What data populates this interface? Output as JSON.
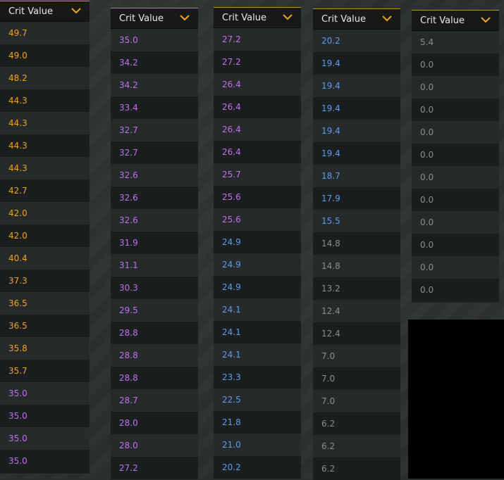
{
  "header_label": "Crit Value",
  "colors": {
    "gold": "#f0a320",
    "purple": "#c070f0",
    "blue": "#5d9cf0",
    "gray": "#8a8e8e"
  },
  "icons": {
    "header_dropdown": "chevron-down-icon"
  },
  "columns": [
    {
      "label": "Crit Value",
      "values": [
        {
          "v": "49.7",
          "c": "gold"
        },
        {
          "v": "49.0",
          "c": "gold"
        },
        {
          "v": "48.2",
          "c": "gold"
        },
        {
          "v": "44.3",
          "c": "gold"
        },
        {
          "v": "44.3",
          "c": "gold"
        },
        {
          "v": "44.3",
          "c": "gold"
        },
        {
          "v": "44.3",
          "c": "gold"
        },
        {
          "v": "42.7",
          "c": "gold"
        },
        {
          "v": "42.0",
          "c": "gold"
        },
        {
          "v": "42.0",
          "c": "gold"
        },
        {
          "v": "40.4",
          "c": "gold"
        },
        {
          "v": "37.3",
          "c": "gold"
        },
        {
          "v": "36.5",
          "c": "gold"
        },
        {
          "v": "36.5",
          "c": "gold"
        },
        {
          "v": "35.8",
          "c": "gold"
        },
        {
          "v": "35.7",
          "c": "gold"
        },
        {
          "v": "35.0",
          "c": "purple"
        },
        {
          "v": "35.0",
          "c": "purple"
        },
        {
          "v": "35.0",
          "c": "purple"
        },
        {
          "v": "35.0",
          "c": "purple"
        }
      ]
    },
    {
      "label": "Crit Value",
      "values": [
        {
          "v": "35.0",
          "c": "purple"
        },
        {
          "v": "34.2",
          "c": "purple"
        },
        {
          "v": "34.2",
          "c": "purple"
        },
        {
          "v": "33.4",
          "c": "purple"
        },
        {
          "v": "32.7",
          "c": "purple"
        },
        {
          "v": "32.7",
          "c": "purple"
        },
        {
          "v": "32.6",
          "c": "purple"
        },
        {
          "v": "32.6",
          "c": "purple"
        },
        {
          "v": "32.6",
          "c": "purple"
        },
        {
          "v": "31.9",
          "c": "purple"
        },
        {
          "v": "31.1",
          "c": "purple"
        },
        {
          "v": "30.3",
          "c": "purple"
        },
        {
          "v": "29.5",
          "c": "purple"
        },
        {
          "v": "28.8",
          "c": "purple"
        },
        {
          "v": "28.8",
          "c": "purple"
        },
        {
          "v": "28.8",
          "c": "purple"
        },
        {
          "v": "28.7",
          "c": "purple"
        },
        {
          "v": "28.0",
          "c": "purple"
        },
        {
          "v": "28.0",
          "c": "purple"
        },
        {
          "v": "27.2",
          "c": "purple"
        }
      ]
    },
    {
      "label": "Crit Value",
      "values": [
        {
          "v": "27.2",
          "c": "purple"
        },
        {
          "v": "27.2",
          "c": "purple"
        },
        {
          "v": "26.4",
          "c": "purple"
        },
        {
          "v": "26.4",
          "c": "purple"
        },
        {
          "v": "26.4",
          "c": "purple"
        },
        {
          "v": "26.4",
          "c": "purple"
        },
        {
          "v": "25.7",
          "c": "purple"
        },
        {
          "v": "25.6",
          "c": "purple"
        },
        {
          "v": "25.6",
          "c": "purple"
        },
        {
          "v": "24.9",
          "c": "blue"
        },
        {
          "v": "24.9",
          "c": "blue"
        },
        {
          "v": "24.9",
          "c": "blue"
        },
        {
          "v": "24.1",
          "c": "blue"
        },
        {
          "v": "24.1",
          "c": "blue"
        },
        {
          "v": "24.1",
          "c": "blue"
        },
        {
          "v": "23.3",
          "c": "blue"
        },
        {
          "v": "22.5",
          "c": "blue"
        },
        {
          "v": "21.8",
          "c": "blue"
        },
        {
          "v": "21.0",
          "c": "blue"
        },
        {
          "v": "20.2",
          "c": "blue"
        }
      ]
    },
    {
      "label": "Crit Value",
      "values": [
        {
          "v": "20.2",
          "c": "blue"
        },
        {
          "v": "19.4",
          "c": "blue"
        },
        {
          "v": "19.4",
          "c": "blue"
        },
        {
          "v": "19.4",
          "c": "blue"
        },
        {
          "v": "19.4",
          "c": "blue"
        },
        {
          "v": "19.4",
          "c": "blue"
        },
        {
          "v": "18.7",
          "c": "blue"
        },
        {
          "v": "17.9",
          "c": "blue"
        },
        {
          "v": "15.5",
          "c": "blue"
        },
        {
          "v": "14.8",
          "c": "gray"
        },
        {
          "v": "14.8",
          "c": "gray"
        },
        {
          "v": "13.2",
          "c": "gray"
        },
        {
          "v": "12.4",
          "c": "gray"
        },
        {
          "v": "12.4",
          "c": "gray"
        },
        {
          "v": "7.0",
          "c": "gray"
        },
        {
          "v": "7.0",
          "c": "gray"
        },
        {
          "v": "7.0",
          "c": "gray"
        },
        {
          "v": "6.2",
          "c": "gray"
        },
        {
          "v": "6.2",
          "c": "gray"
        },
        {
          "v": "6.2",
          "c": "gray"
        }
      ]
    },
    {
      "label": "Crit Value",
      "values": [
        {
          "v": "5.4",
          "c": "gray"
        },
        {
          "v": "0.0",
          "c": "gray"
        },
        {
          "v": "0.0",
          "c": "gray"
        },
        {
          "v": "0.0",
          "c": "gray"
        },
        {
          "v": "0.0",
          "c": "gray"
        },
        {
          "v": "0.0",
          "c": "gray"
        },
        {
          "v": "0.0",
          "c": "gray"
        },
        {
          "v": "0.0",
          "c": "gray"
        },
        {
          "v": "0.0",
          "c": "gray"
        },
        {
          "v": "0.0",
          "c": "gray"
        },
        {
          "v": "0.0",
          "c": "gray"
        },
        {
          "v": "0.0",
          "c": "gray"
        }
      ]
    }
  ]
}
